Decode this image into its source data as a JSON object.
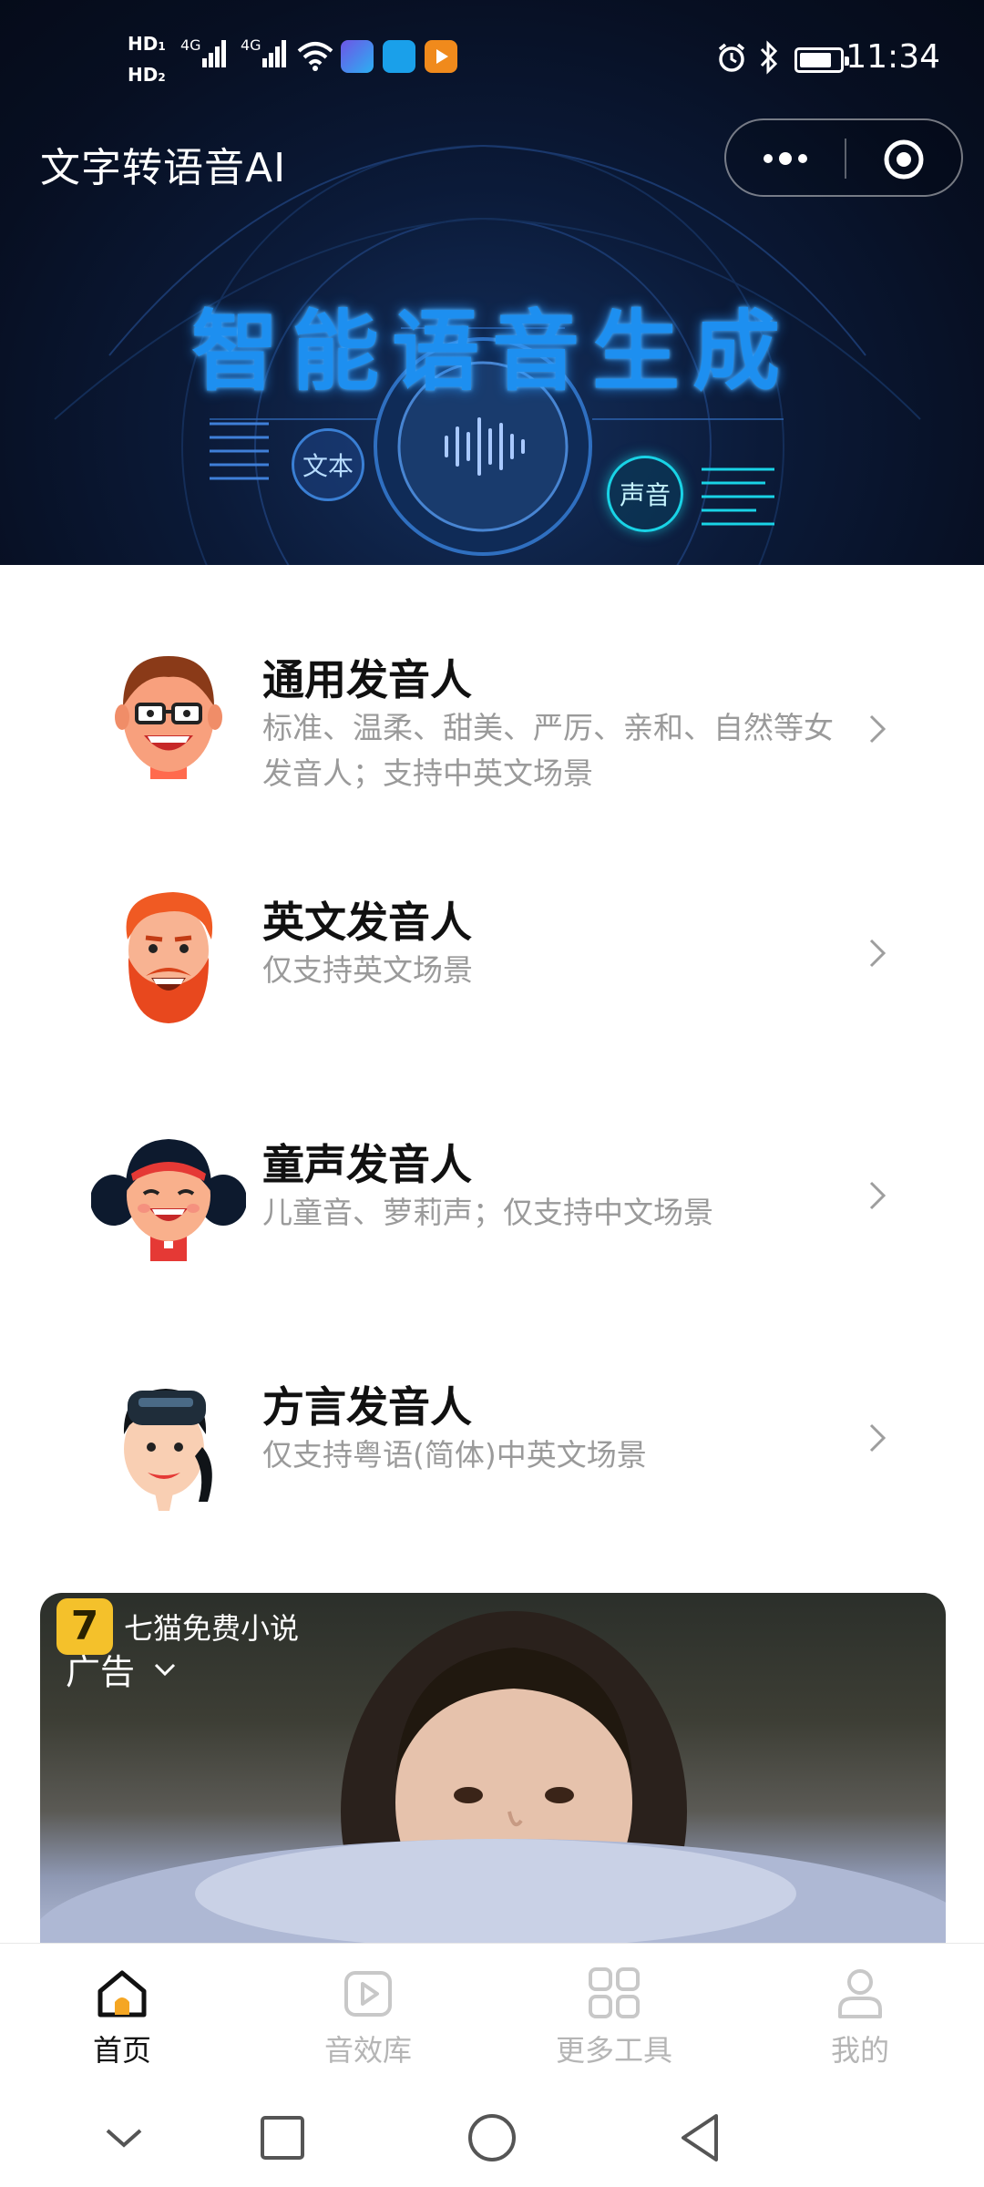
{
  "status_bar": {
    "time": "11:34",
    "sim1_label": "HD",
    "sim2_label": "HD",
    "network1": "4G",
    "network2": "4G"
  },
  "header": {
    "title": "文字转语音AI"
  },
  "banner": {
    "heading": "智能语音生成",
    "left_bubble": "文本",
    "right_bubble": "声音"
  },
  "voices": [
    {
      "title": "通用发音人",
      "desc": "标准、温柔、甜美、严厉、亲和、自然等女发音人；支持中英文场景",
      "avatar": "man-glasses-avatar"
    },
    {
      "title": "英文发音人",
      "desc": "仅支持英文场景",
      "avatar": "bearded-man-avatar"
    },
    {
      "title": "童声发音人",
      "desc": "儿童音、萝莉声；仅支持中文场景",
      "avatar": "girl-avatar"
    },
    {
      "title": "方言发音人",
      "desc": "仅支持粤语(简体)中英文场景",
      "avatar": "dialect-avatar"
    }
  ],
  "ad": {
    "brand": "七猫免费小说",
    "label": "广告",
    "logo_text": "7"
  },
  "tabs": [
    {
      "label": "首页",
      "icon": "home-icon",
      "active": true
    },
    {
      "label": "音效库",
      "icon": "play-library-icon",
      "active": false
    },
    {
      "label": "更多工具",
      "icon": "grid-tools-icon",
      "active": false
    },
    {
      "label": "我的",
      "icon": "profile-icon",
      "active": false
    }
  ],
  "colors": {
    "banner_bg": "#0b1a38",
    "heading_blue": "#1d8ff0",
    "title_text": "#111111",
    "desc_text": "#9a9a9a",
    "tab_inactive": "#b5b5b5"
  }
}
